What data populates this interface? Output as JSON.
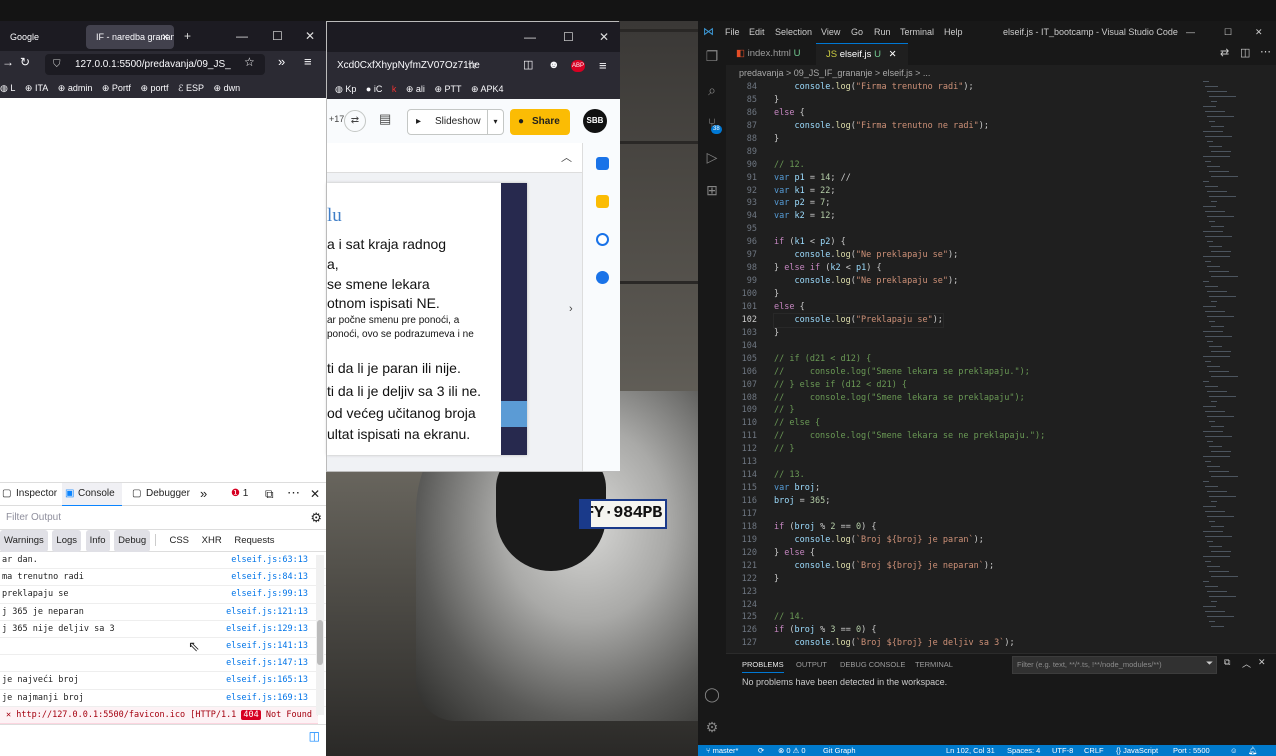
{
  "firefox": {
    "tabs": [
      {
        "label": "Google",
        "active": false
      },
      {
        "label": "IF - naredba granan",
        "active": true
      }
    ],
    "new_tab": "+",
    "url": "127.0.0.1:5500/predavanja/09_JS_",
    "bookmarks": [
      "L",
      "ITA",
      "admin",
      "Portf",
      "portf",
      "ESP",
      "dwn"
    ],
    "devtools": {
      "tabs": [
        "Inspector",
        "Console",
        "Debugger"
      ],
      "active_tab": "Console",
      "error_count": "1",
      "filter_placeholder": "Filter Output",
      "levels": [
        "Warnings",
        "Logs",
        "Info",
        "Debug"
      ],
      "extra_filters": [
        "CSS",
        "XHR",
        "Requests"
      ],
      "console_lines": [
        {
          "msg": "ar dan.",
          "src": "elseif.js:63:13"
        },
        {
          "msg": "ma trenutno radi",
          "src": "elseif.js:84:13"
        },
        {
          "msg": "preklapaju se",
          "src": "elseif.js:99:13"
        },
        {
          "msg": "j 365 je neparan",
          "src": "elseif.js:121:13"
        },
        {
          "msg": "j 365 nije deljiv sa 3",
          "src": "elseif.js:129:13"
        },
        {
          "msg": "",
          "src": "elseif.js:141:13"
        },
        {
          "msg": "",
          "src": "elseif.js:147:13"
        },
        {
          "msg": "je najveći broj",
          "src": "elseif.js:165:13"
        },
        {
          "msg": "je najmanji broj",
          "src": "elseif.js:169:13"
        }
      ],
      "error_line": {
        "text": "http://127.0.0.1:5500/favicon.ico [HTTP/1.1 ",
        "badge": "404",
        "after": " Not Found 0ms]"
      }
    }
  },
  "slides_window": {
    "url": "Xcd0CxfXhypNyfmZV07Oz71he",
    "bookmarks": [
      "Kp",
      "iC",
      "k",
      "ali",
      "PTT",
      "APK4"
    ],
    "collab_count": "+17",
    "slideshow_label": "Slideshow",
    "share_label": "Share",
    "avatar": "SBB",
    "slide": {
      "title": "lu",
      "lines": [
        "a i sat kraja radnog",
        "a,",
        "se smene lekara",
        "otnom ispisati NE.",
        "ar počne smenu pre ponoći, a",
        "ponoći, ovo se podrazumeva i ne",
        "ti da li je paran ili nije.",
        "ti da li je deljiv sa 3 ili ne.",
        " od većeg učitanog broja",
        "ultat ispisati na ekranu."
      ]
    }
  },
  "photo": {
    "plate": "FY·984PB"
  },
  "vscode": {
    "menu": [
      "File",
      "Edit",
      "Selection",
      "View",
      "Go",
      "Run",
      "Terminal",
      "Help"
    ],
    "title": "elseif.js - IT_bootcamp - Visual Studio Code",
    "tabs": [
      {
        "label": "index.html",
        "status": "U",
        "active": false
      },
      {
        "label": "elseif.js",
        "status": "U",
        "active": true
      }
    ],
    "breadcrumb": "predavanja > 09_JS_IF_grananje > elseif.js > ...",
    "source_control_badge": "38",
    "current_line": 102,
    "panel": {
      "tabs": [
        "PROBLEMS",
        "OUTPUT",
        "DEBUG CONSOLE",
        "TERMINAL"
      ],
      "active_tab": "PROBLEMS",
      "filter_placeholder": "Filter (e.g. text, **/*.ts, !**/node_modules/**)",
      "message": "No problems have been detected in the workspace."
    },
    "status": {
      "branch": "master*",
      "problems": "⊗ 0 ⚠ 0",
      "git_graph": "Git Graph",
      "position": "Ln 102, Col 31",
      "spaces": "Spaces: 4",
      "encoding": "UTF-8",
      "eol": "CRLF",
      "language": "{} JavaScript",
      "port": "Port : 5500"
    },
    "code_lines": [
      {
        "n": 84,
        "t": "    console.log(\"Firma trenutno radi\");"
      },
      {
        "n": 85,
        "t": "}"
      },
      {
        "n": 86,
        "t": "else {"
      },
      {
        "n": 87,
        "t": "    console.log(\"Firma trenutno ne radi\");"
      },
      {
        "n": 88,
        "t": "}"
      },
      {
        "n": 89,
        "t": ""
      },
      {
        "n": 90,
        "t": "// 12."
      },
      {
        "n": 91,
        "t": "var p1 = 14; //"
      },
      {
        "n": 92,
        "t": "var k1 = 22;"
      },
      {
        "n": 93,
        "t": "var p2 = 7;"
      },
      {
        "n": 94,
        "t": "var k2 = 12;"
      },
      {
        "n": 95,
        "t": ""
      },
      {
        "n": 96,
        "t": "if (k1 < p2) {"
      },
      {
        "n": 97,
        "t": "    console.log(\"Ne preklapaju se\");"
      },
      {
        "n": 98,
        "t": "} else if (k2 < p1) {"
      },
      {
        "n": 99,
        "t": "    console.log(\"Ne preklapaju se\");"
      },
      {
        "n": 100,
        "t": "}"
      },
      {
        "n": 101,
        "t": "else {"
      },
      {
        "n": 102,
        "t": "    console.log(\"Preklapaju se\");"
      },
      {
        "n": 103,
        "t": "}"
      },
      {
        "n": 104,
        "t": ""
      },
      {
        "n": 105,
        "t": "// if (d21 < d12) {"
      },
      {
        "n": 106,
        "t": "//     console.log(\"Smene lekara se preklapaju.\");"
      },
      {
        "n": 107,
        "t": "// } else if (d12 < d21) {"
      },
      {
        "n": 108,
        "t": "//     console.log(\"Smene lekara se preklapaju\");"
      },
      {
        "n": 109,
        "t": "// }"
      },
      {
        "n": 110,
        "t": "// else {"
      },
      {
        "n": 111,
        "t": "//     console.log(\"Smene lekara se ne preklapaju.\");"
      },
      {
        "n": 112,
        "t": "// }"
      },
      {
        "n": 113,
        "t": ""
      },
      {
        "n": 114,
        "t": "// 13."
      },
      {
        "n": 115,
        "t": "var broj;"
      },
      {
        "n": 116,
        "t": "broj = 365;"
      },
      {
        "n": 117,
        "t": ""
      },
      {
        "n": 118,
        "t": "if (broj % 2 == 0) {"
      },
      {
        "n": 119,
        "t": "    console.log(`Broj ${broj} je paran`);"
      },
      {
        "n": 120,
        "t": "} else {"
      },
      {
        "n": 121,
        "t": "    console.log(`Broj ${broj} je neparan`);"
      },
      {
        "n": 122,
        "t": "}"
      },
      {
        "n": 123,
        "t": ""
      },
      {
        "n": 124,
        "t": ""
      },
      {
        "n": 125,
        "t": "// 14."
      },
      {
        "n": 126,
        "t": "if (broj % 3 == 0) {"
      },
      {
        "n": 127,
        "t": "    console.log(`Broj ${broj} je deljiv sa 3`);"
      }
    ]
  },
  "colors": {
    "accent_blue": "#007acc",
    "share_yellow": "#fbbc04",
    "error_red": "#d70022",
    "firefox_dark": "#1c1b22",
    "slide_navy": "#27294e"
  }
}
